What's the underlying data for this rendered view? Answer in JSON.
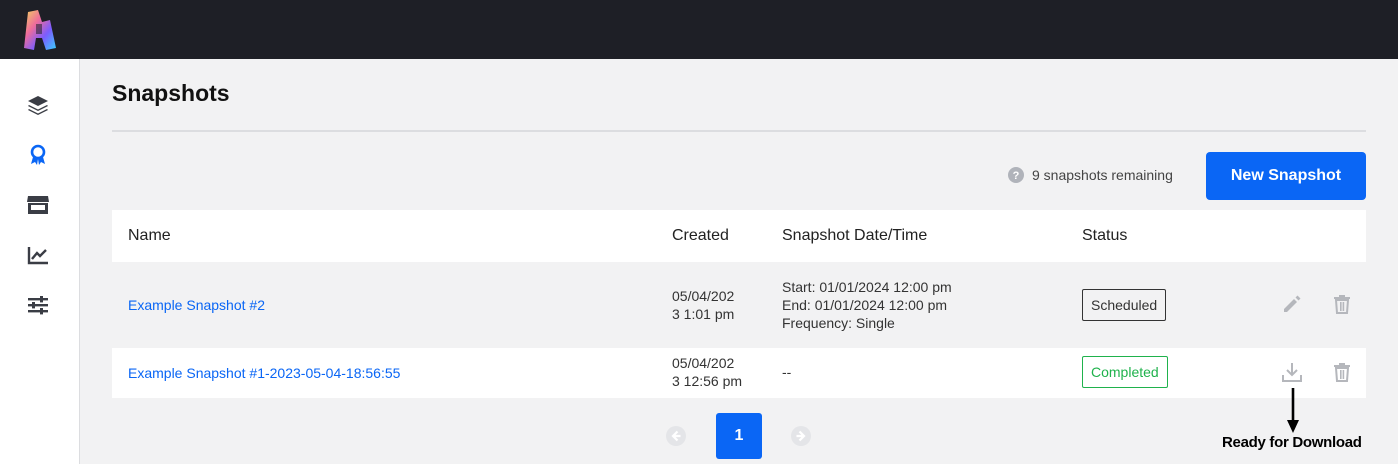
{
  "page": {
    "title": "Snapshots"
  },
  "sidebar": {
    "items": [
      {
        "icon": "layers-icon"
      },
      {
        "icon": "badge-icon"
      },
      {
        "icon": "store-icon"
      },
      {
        "icon": "chart-icon"
      },
      {
        "icon": "sliders-icon"
      }
    ]
  },
  "toolbar": {
    "remaining_text": "9 snapshots remaining",
    "new_button": "New Snapshot"
  },
  "table": {
    "headers": {
      "name": "Name",
      "created": "Created",
      "datetime": "Snapshot Date/Time",
      "status": "Status"
    },
    "rows": [
      {
        "name": "Example Snapshot #2",
        "created_line1": "05/04/202",
        "created_line2": "3 1:01 pm",
        "start": "Start: 01/01/2024 12:00 pm",
        "end": "End: 01/01/2024 12:00 pm",
        "frequency": "Frequency: Single",
        "status": "Scheduled"
      },
      {
        "name": "Example Snapshot #1-2023-05-04-18:56:55",
        "created_line1": "05/04/202",
        "created_line2": "3 12:56 pm",
        "datetime": "--",
        "status": "Completed"
      }
    ]
  },
  "pagination": {
    "current": "1"
  },
  "annotation": {
    "text": "Ready for Download"
  },
  "colors": {
    "accent": "#0a66f5",
    "topbar": "#1e1f26",
    "completed": "#1fb24c"
  }
}
